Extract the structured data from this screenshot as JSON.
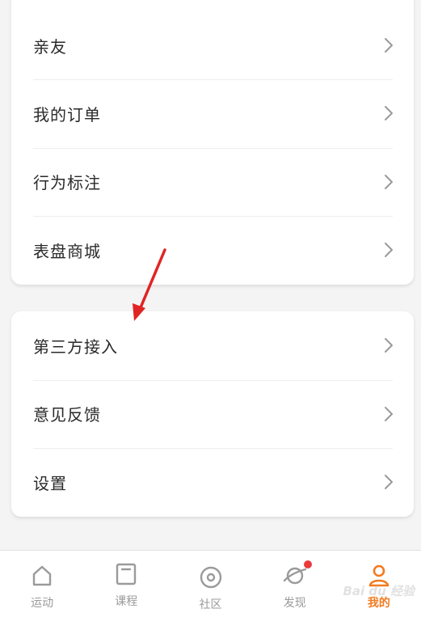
{
  "group1": {
    "items": [
      {
        "label": "亲友"
      },
      {
        "label": "我的订单"
      },
      {
        "label": "行为标注"
      },
      {
        "label": "表盘商城"
      }
    ]
  },
  "group2": {
    "items": [
      {
        "label": "第三方接入"
      },
      {
        "label": "意见反馈"
      },
      {
        "label": "设置"
      }
    ]
  },
  "tabbar": {
    "tabs": [
      {
        "label": "运动",
        "icon": "home-icon"
      },
      {
        "label": "课程",
        "icon": "course-icon"
      },
      {
        "label": "社区",
        "icon": "community-icon"
      },
      {
        "label": "发现",
        "icon": "discover-icon",
        "badge": true
      },
      {
        "label": "我的",
        "icon": "profile-icon",
        "active": true
      }
    ]
  },
  "colors": {
    "accent": "#f47a1f",
    "annotation_arrow": "#e02424",
    "badge": "#ea3b3b",
    "inactive": "#9a9a9a"
  },
  "watermark": "Bai du 经验"
}
